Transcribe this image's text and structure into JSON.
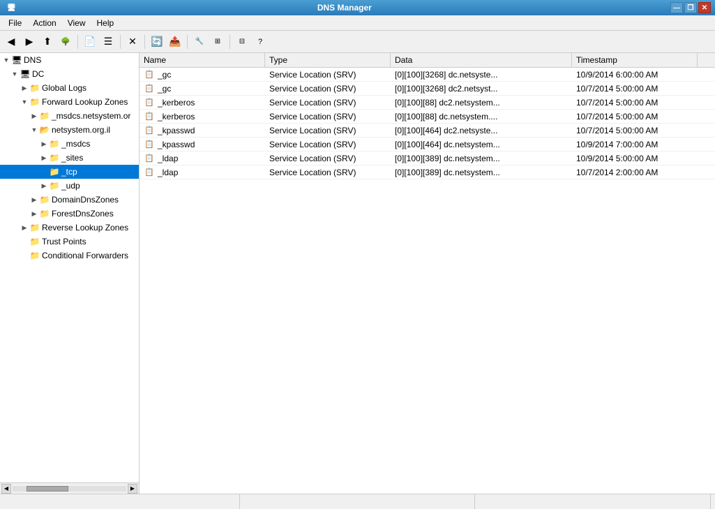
{
  "titleBar": {
    "title": "DNS Manager",
    "buttons": [
      "minimize",
      "restore",
      "close"
    ]
  },
  "menuBar": {
    "items": [
      "File",
      "Action",
      "View",
      "Help"
    ]
  },
  "toolbar": {
    "buttons": [
      "back",
      "forward",
      "up",
      "show-tree",
      "separator",
      "new",
      "properties",
      "separator",
      "delete",
      "separator",
      "refresh",
      "export",
      "separator",
      "wizard",
      "tabs",
      "separator",
      "filter",
      "help"
    ]
  },
  "tree": {
    "items": [
      {
        "id": "dns",
        "label": "DNS",
        "level": 0,
        "expanded": true,
        "icon": "server",
        "hasExpander": false
      },
      {
        "id": "dc",
        "label": "DC",
        "level": 1,
        "expanded": true,
        "icon": "server",
        "hasExpander": true
      },
      {
        "id": "global-logs",
        "label": "Global Logs",
        "level": 2,
        "expanded": false,
        "icon": "folder",
        "hasExpander": true
      },
      {
        "id": "forward-lookup",
        "label": "Forward Lookup Zones",
        "level": 2,
        "expanded": true,
        "icon": "folder",
        "hasExpander": true
      },
      {
        "id": "msdcs",
        "label": "_msdcs.netsystem.or",
        "level": 3,
        "expanded": false,
        "icon": "folder",
        "hasExpander": true
      },
      {
        "id": "netsystem",
        "label": "netsystem.org.il",
        "level": 3,
        "expanded": true,
        "icon": "folder-open",
        "hasExpander": true
      },
      {
        "id": "msdcs2",
        "label": "_msdcs",
        "level": 4,
        "expanded": false,
        "icon": "folder",
        "hasExpander": true
      },
      {
        "id": "sites",
        "label": "_sites",
        "level": 4,
        "expanded": false,
        "icon": "folder",
        "hasExpander": true
      },
      {
        "id": "tcp",
        "label": "_tcp",
        "level": 4,
        "expanded": false,
        "icon": "folder-selected",
        "hasExpander": false,
        "selected": true
      },
      {
        "id": "udp",
        "label": "_udp",
        "level": 4,
        "expanded": false,
        "icon": "folder",
        "hasExpander": true
      },
      {
        "id": "domain-dns",
        "label": "DomainDnsZones",
        "level": 3,
        "expanded": false,
        "icon": "folder",
        "hasExpander": true
      },
      {
        "id": "forest-dns",
        "label": "ForestDnsZones",
        "level": 3,
        "expanded": false,
        "icon": "folder",
        "hasExpander": true
      },
      {
        "id": "reverse-lookup",
        "label": "Reverse Lookup Zones",
        "level": 2,
        "expanded": false,
        "icon": "folder",
        "hasExpander": true
      },
      {
        "id": "trust-points",
        "label": "Trust Points",
        "level": 2,
        "expanded": false,
        "icon": "folder",
        "hasExpander": false
      },
      {
        "id": "conditional-fwd",
        "label": "Conditional Forwarders",
        "level": 2,
        "expanded": false,
        "icon": "folder",
        "hasExpander": false
      }
    ]
  },
  "listHeader": {
    "columns": [
      "Name",
      "Type",
      "Data",
      "Timestamp"
    ]
  },
  "listRows": [
    {
      "name": "_gc",
      "type": "Service Location (SRV)",
      "data": "[0][100][3268] dc.netsyste...",
      "timestamp": "10/9/2014 6:00:00 AM"
    },
    {
      "name": "_gc",
      "type": "Service Location (SRV)",
      "data": "[0][100][3268] dc2.netsyst...",
      "timestamp": "10/7/2014 5:00:00 AM"
    },
    {
      "name": "_kerberos",
      "type": "Service Location (SRV)",
      "data": "[0][100][88] dc2.netsystem...",
      "timestamp": "10/7/2014 5:00:00 AM"
    },
    {
      "name": "_kerberos",
      "type": "Service Location (SRV)",
      "data": "[0][100][88] dc.netsystem....",
      "timestamp": "10/7/2014 5:00:00 AM"
    },
    {
      "name": "_kpasswd",
      "type": "Service Location (SRV)",
      "data": "[0][100][464] dc2.netsyste...",
      "timestamp": "10/7/2014 5:00:00 AM"
    },
    {
      "name": "_kpasswd",
      "type": "Service Location (SRV)",
      "data": "[0][100][464] dc.netsystem...",
      "timestamp": "10/9/2014 7:00:00 AM"
    },
    {
      "name": "_ldap",
      "type": "Service Location (SRV)",
      "data": "[0][100][389] dc.netsystem...",
      "timestamp": "10/9/2014 5:00:00 AM"
    },
    {
      "name": "_ldap",
      "type": "Service Location (SRV)",
      "data": "[0][100][389] dc.netsystem...",
      "timestamp": "10/7/2014 2:00:00 AM"
    }
  ],
  "statusBar": {
    "text": ""
  }
}
